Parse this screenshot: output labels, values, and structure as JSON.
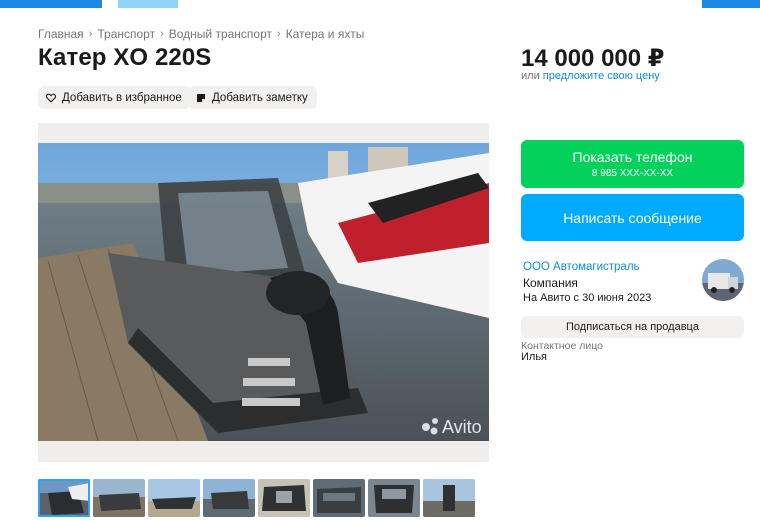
{
  "breadcrumbs": [
    "Главная",
    "Транспорт",
    "Водный транспорт",
    "Катера и яхты"
  ],
  "title": "Катер XO 220S",
  "price": {
    "amount": "14 000 000 ₽",
    "prefix": "или",
    "offer_link": "предложите свою цену"
  },
  "actions": {
    "favorite": "Добавить в избранное",
    "note": "Добавить заметку"
  },
  "photo": {
    "watermark": "Avito",
    "thumbnail_count": 8,
    "active_index": 0
  },
  "contact_buttons": {
    "show_phone": "Показать телефон",
    "phone_masked": "8 985 XXX-XX-XX",
    "write_message": "Написать сообщение"
  },
  "seller": {
    "name": "ООО Автомагистраль",
    "type": "Компания",
    "since": "На Авито с 30 июня 2023",
    "subscribe": "Подписаться на продавца",
    "contact_label": "Контактное лицо",
    "contact_name": "Илья"
  },
  "colors": {
    "phone_button": "#02d15c",
    "message_button": "#00aaff",
    "link": "#0a8ed9",
    "chip_bg": "#f2f1f0"
  },
  "icons": [
    "heart-icon",
    "note-icon",
    "chevron-right-icon",
    "avito-logo-icon"
  ]
}
